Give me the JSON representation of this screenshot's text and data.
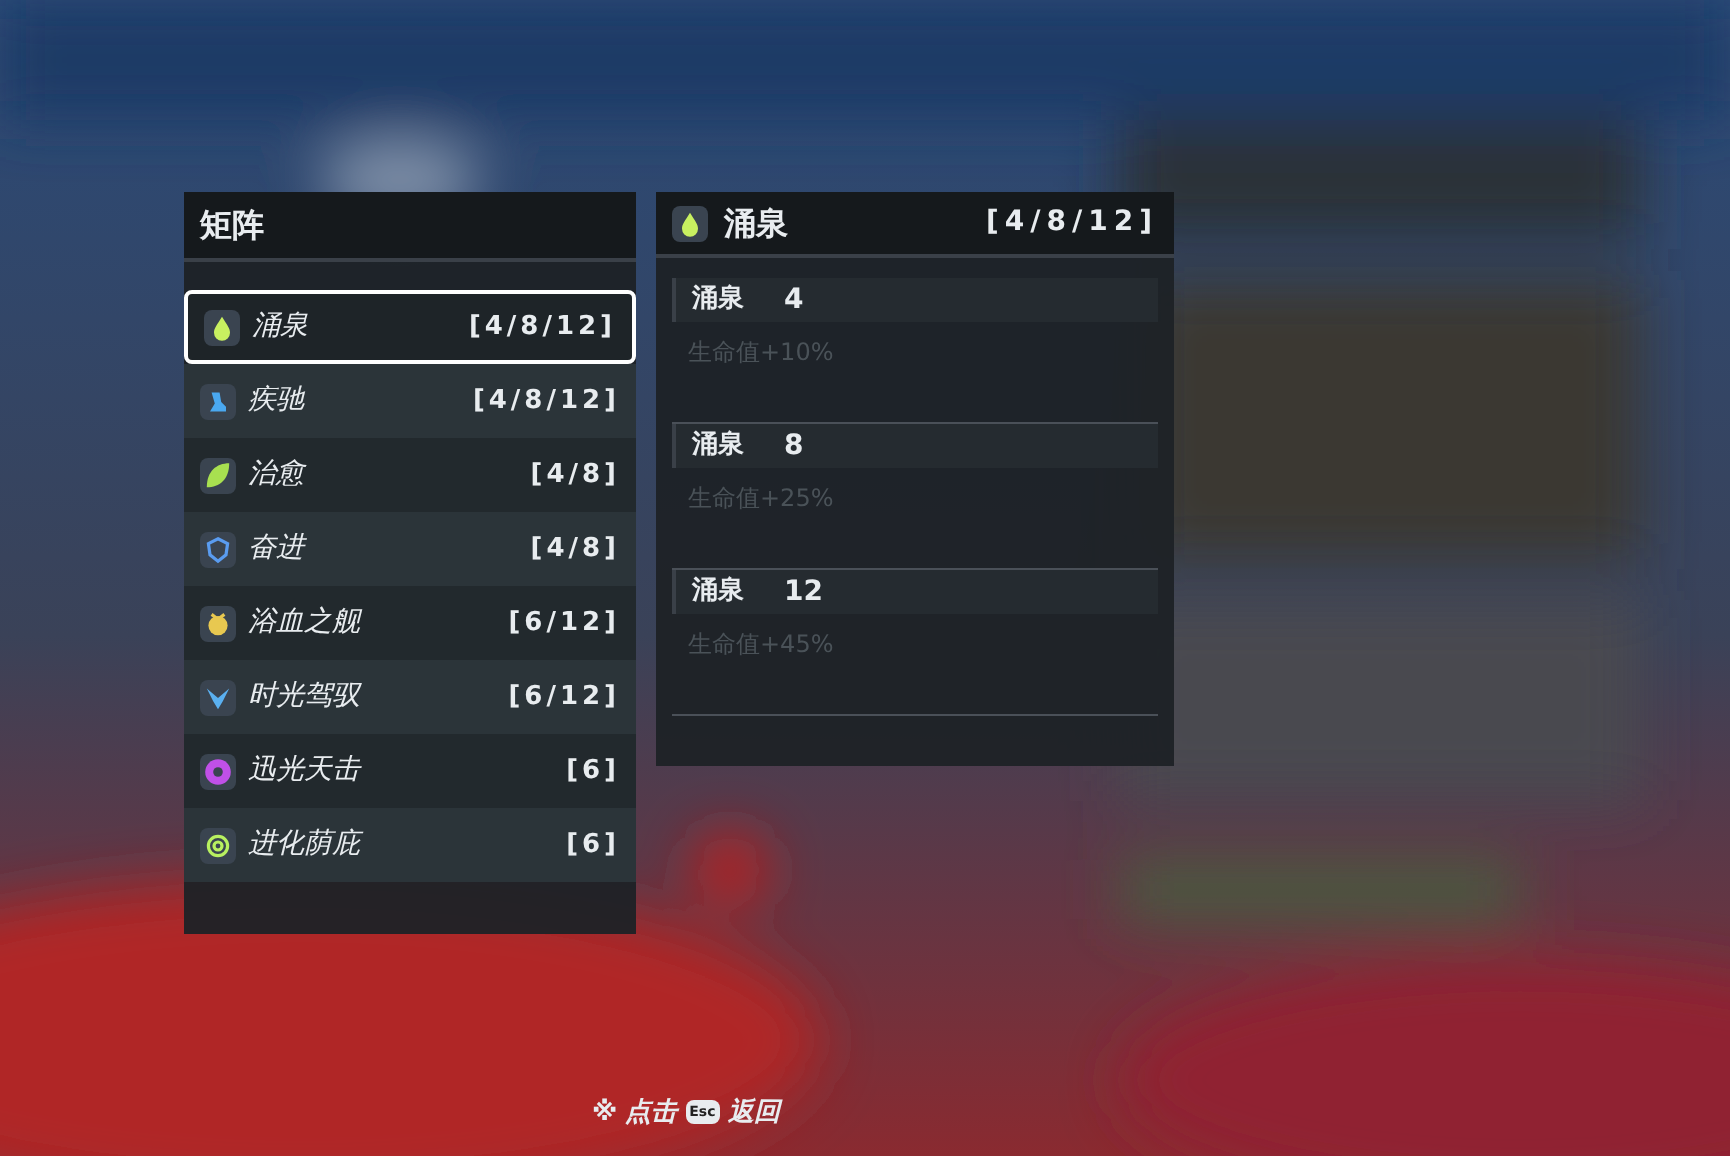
{
  "panel": {
    "title": "矩阵",
    "items": [
      {
        "name": "涌泉",
        "tiers": "[4/8/12]",
        "selected": true,
        "color": "#c8f060"
      },
      {
        "name": "疾驰",
        "tiers": "[4/8/12]",
        "selected": false,
        "color": "#4aa8f0"
      },
      {
        "name": "治愈",
        "tiers": "[4/8]",
        "selected": false,
        "color": "#a8e050"
      },
      {
        "name": "奋进",
        "tiers": "[4/8]",
        "selected": false,
        "color": "#5a9cf0"
      },
      {
        "name": "浴血之舰",
        "tiers": "[6/12]",
        "selected": false,
        "color": "#e8c850"
      },
      {
        "name": "时光驾驭",
        "tiers": "[6/12]",
        "selected": false,
        "color": "#5ab0f0"
      },
      {
        "name": "迅光天击",
        "tiers": "[6]",
        "selected": false,
        "color": "#c050e8"
      },
      {
        "name": "进化荫庇",
        "tiers": "[6]",
        "selected": false,
        "color": "#b8f060"
      }
    ]
  },
  "detail": {
    "name": "涌泉",
    "tiers": "[4/8/12]",
    "color": "#c8f060",
    "effects": [
      {
        "name": "涌泉",
        "count": "4",
        "bonus": "生命值+10%"
      },
      {
        "name": "涌泉",
        "count": "8",
        "bonus": "生命值+25%"
      },
      {
        "name": "涌泉",
        "count": "12",
        "bonus": "生命值+45%"
      }
    ]
  },
  "footer": {
    "mark": "※",
    "prefix": "点击",
    "key": "Esc",
    "suffix": "返回"
  }
}
